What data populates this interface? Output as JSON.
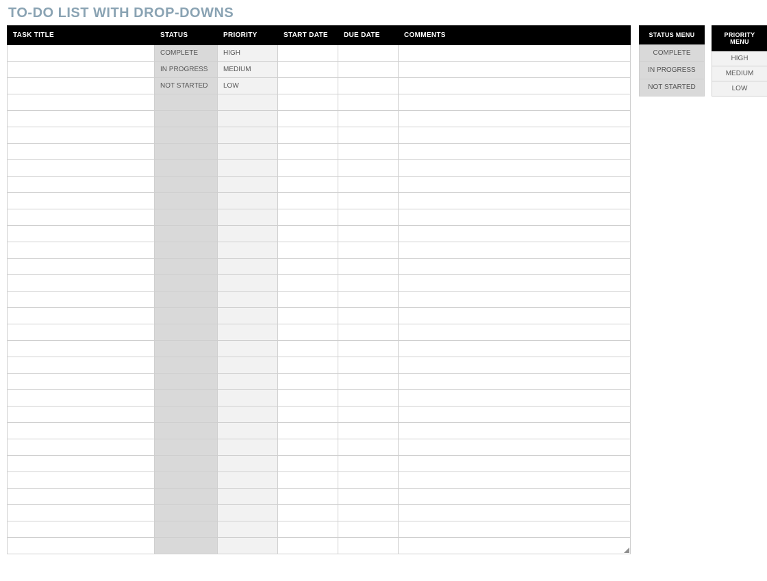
{
  "title": "TO-DO LIST WITH DROP-DOWNS",
  "columns": {
    "task": "TASK TITLE",
    "status": "STATUS",
    "priority": "PRIORITY",
    "start": "START DATE",
    "due": "DUE DATE",
    "comments": "COMMENTS"
  },
  "rows": [
    {
      "task": "",
      "status": "COMPLETE",
      "priority": "HIGH",
      "start": "",
      "due": "",
      "comments": ""
    },
    {
      "task": "",
      "status": "IN PROGRESS",
      "priority": "MEDIUM",
      "start": "",
      "due": "",
      "comments": ""
    },
    {
      "task": "",
      "status": "NOT STARTED",
      "priority": "LOW",
      "start": "",
      "due": "",
      "comments": ""
    },
    {
      "task": "",
      "status": "",
      "priority": "",
      "start": "",
      "due": "",
      "comments": ""
    },
    {
      "task": "",
      "status": "",
      "priority": "",
      "start": "",
      "due": "",
      "comments": ""
    },
    {
      "task": "",
      "status": "",
      "priority": "",
      "start": "",
      "due": "",
      "comments": ""
    },
    {
      "task": "",
      "status": "",
      "priority": "",
      "start": "",
      "due": "",
      "comments": ""
    },
    {
      "task": "",
      "status": "",
      "priority": "",
      "start": "",
      "due": "",
      "comments": ""
    },
    {
      "task": "",
      "status": "",
      "priority": "",
      "start": "",
      "due": "",
      "comments": ""
    },
    {
      "task": "",
      "status": "",
      "priority": "",
      "start": "",
      "due": "",
      "comments": ""
    },
    {
      "task": "",
      "status": "",
      "priority": "",
      "start": "",
      "due": "",
      "comments": ""
    },
    {
      "task": "",
      "status": "",
      "priority": "",
      "start": "",
      "due": "",
      "comments": ""
    },
    {
      "task": "",
      "status": "",
      "priority": "",
      "start": "",
      "due": "",
      "comments": ""
    },
    {
      "task": "",
      "status": "",
      "priority": "",
      "start": "",
      "due": "",
      "comments": ""
    },
    {
      "task": "",
      "status": "",
      "priority": "",
      "start": "",
      "due": "",
      "comments": ""
    },
    {
      "task": "",
      "status": "",
      "priority": "",
      "start": "",
      "due": "",
      "comments": ""
    },
    {
      "task": "",
      "status": "",
      "priority": "",
      "start": "",
      "due": "",
      "comments": ""
    },
    {
      "task": "",
      "status": "",
      "priority": "",
      "start": "",
      "due": "",
      "comments": ""
    },
    {
      "task": "",
      "status": "",
      "priority": "",
      "start": "",
      "due": "",
      "comments": ""
    },
    {
      "task": "",
      "status": "",
      "priority": "",
      "start": "",
      "due": "",
      "comments": ""
    },
    {
      "task": "",
      "status": "",
      "priority": "",
      "start": "",
      "due": "",
      "comments": ""
    },
    {
      "task": "",
      "status": "",
      "priority": "",
      "start": "",
      "due": "",
      "comments": ""
    },
    {
      "task": "",
      "status": "",
      "priority": "",
      "start": "",
      "due": "",
      "comments": ""
    },
    {
      "task": "",
      "status": "",
      "priority": "",
      "start": "",
      "due": "",
      "comments": ""
    },
    {
      "task": "",
      "status": "",
      "priority": "",
      "start": "",
      "due": "",
      "comments": ""
    },
    {
      "task": "",
      "status": "",
      "priority": "",
      "start": "",
      "due": "",
      "comments": ""
    },
    {
      "task": "",
      "status": "",
      "priority": "",
      "start": "",
      "due": "",
      "comments": ""
    },
    {
      "task": "",
      "status": "",
      "priority": "",
      "start": "",
      "due": "",
      "comments": ""
    },
    {
      "task": "",
      "status": "",
      "priority": "",
      "start": "",
      "due": "",
      "comments": ""
    },
    {
      "task": "",
      "status": "",
      "priority": "",
      "start": "",
      "due": "",
      "comments": ""
    },
    {
      "task": "",
      "status": "",
      "priority": "",
      "start": "",
      "due": "",
      "comments": ""
    }
  ],
  "status_menu": {
    "header": "STATUS MENU",
    "items": [
      "COMPLETE",
      "IN PROGRESS",
      "NOT STARTED"
    ]
  },
  "priority_menu": {
    "header": "PRIORITY MENU",
    "items": [
      "HIGH",
      "MEDIUM",
      "LOW"
    ]
  }
}
